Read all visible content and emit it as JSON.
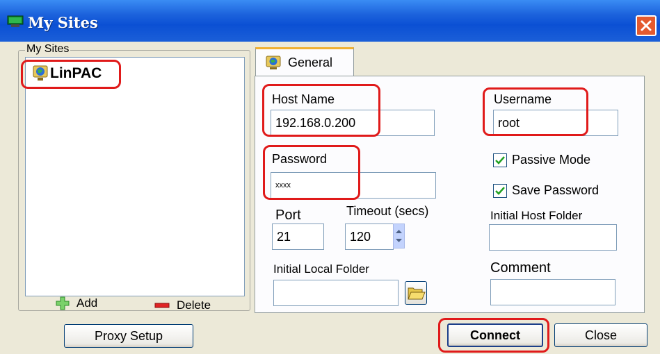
{
  "window": {
    "title": "My Sites"
  },
  "sites": {
    "group_label": "My Sites",
    "items": [
      {
        "label": "LinPAC"
      }
    ],
    "add_label": "Add",
    "delete_label": "Delete"
  },
  "buttons": {
    "proxy_setup": "Proxy Setup",
    "connect": "Connect",
    "close": "Close"
  },
  "tabs": [
    {
      "label": "General"
    }
  ],
  "form": {
    "host_name": {
      "label": "Host Name",
      "value": "192.168.0.200"
    },
    "username": {
      "label": "Username",
      "value": "root"
    },
    "password": {
      "label": "Password",
      "value": "xxxx"
    },
    "passive_mode": {
      "label": "Passive Mode",
      "checked": true
    },
    "save_password": {
      "label": "Save Password",
      "checked": true
    },
    "port": {
      "label": "Port",
      "value": "21"
    },
    "timeout": {
      "label": "Timeout (secs)",
      "value": "120"
    },
    "initial_host_folder": {
      "label": "Initial Host Folder",
      "value": ""
    },
    "initial_local_folder": {
      "label": "Initial Local Folder",
      "value": ""
    },
    "comment": {
      "label": "Comment",
      "value": ""
    }
  },
  "colors": {
    "highlight": "#e01a1a",
    "titlebar": "#0b50d4",
    "face": "#ece9d8"
  },
  "icons": {
    "app": "monitor-icon",
    "site": "globe-computer-icon",
    "add": "plus-icon",
    "delete": "minus-icon",
    "folder": "open-folder-icon",
    "close": "close-icon"
  }
}
